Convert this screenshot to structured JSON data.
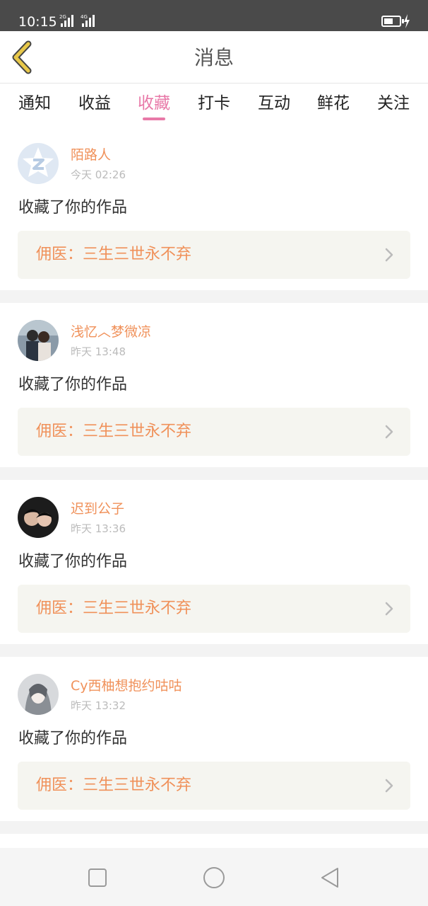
{
  "status_bar": {
    "time": "10:15",
    "network_1": "2G",
    "network_2": "4G"
  },
  "header": {
    "title": "消息",
    "back_icon": "chevron-left-icon"
  },
  "tabs": [
    {
      "label": "通知",
      "active": false
    },
    {
      "label": "收益",
      "active": false
    },
    {
      "label": "收藏",
      "active": true
    },
    {
      "label": "打卡",
      "active": false
    },
    {
      "label": "互动",
      "active": false
    },
    {
      "label": "鲜花",
      "active": false
    },
    {
      "label": "关注",
      "active": false
    }
  ],
  "messages": [
    {
      "user": "陌路人",
      "time": "今天 02:26",
      "action": "收藏了你的作品",
      "work": "佣医：三生三世永不弃"
    },
    {
      "user": "浅忆︿梦微凉",
      "time": "昨天 13:48",
      "action": "收藏了你的作品",
      "work": "佣医：三生三世永不弃"
    },
    {
      "user": "迟到公子",
      "time": "昨天 13:36",
      "action": "收藏了你的作品",
      "work": "佣医：三生三世永不弃"
    },
    {
      "user": "Cy西柚想抱约咕咕",
      "time": "昨天 13:32",
      "action": "收藏了你的作品",
      "work": "佣医：三生三世永不弃"
    }
  ],
  "colors": {
    "accent_pink": "#e879a8",
    "name_orange": "#f0915a",
    "status_bar": "#4a4a4a",
    "back_icon_yellow": "#e8c84a"
  },
  "nav_bar": {
    "icons": [
      "recent-apps-square-icon",
      "home-circle-icon",
      "back-triangle-icon"
    ]
  }
}
